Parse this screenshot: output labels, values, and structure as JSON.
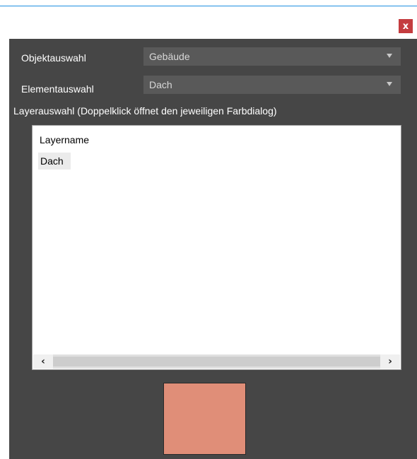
{
  "window": {
    "close_label": "x"
  },
  "object_selection": {
    "label": "Objektauswahl",
    "value": "Gebäude"
  },
  "element_selection": {
    "label": "Elementauswahl",
    "value": "Dach"
  },
  "layer_selection": {
    "label": "Layerauswahl (Doppelklick öffnet den jeweiligen Farbdialog)",
    "column_header": "Layername",
    "items": [
      "Dach"
    ]
  },
  "scrollbar": {
    "left_glyph": "‹",
    "right_glyph": "›"
  },
  "colors": {
    "accent": "#1e8fe0",
    "close": "#c43c3f",
    "panel": "#464646",
    "swatch": "#e08e78"
  }
}
